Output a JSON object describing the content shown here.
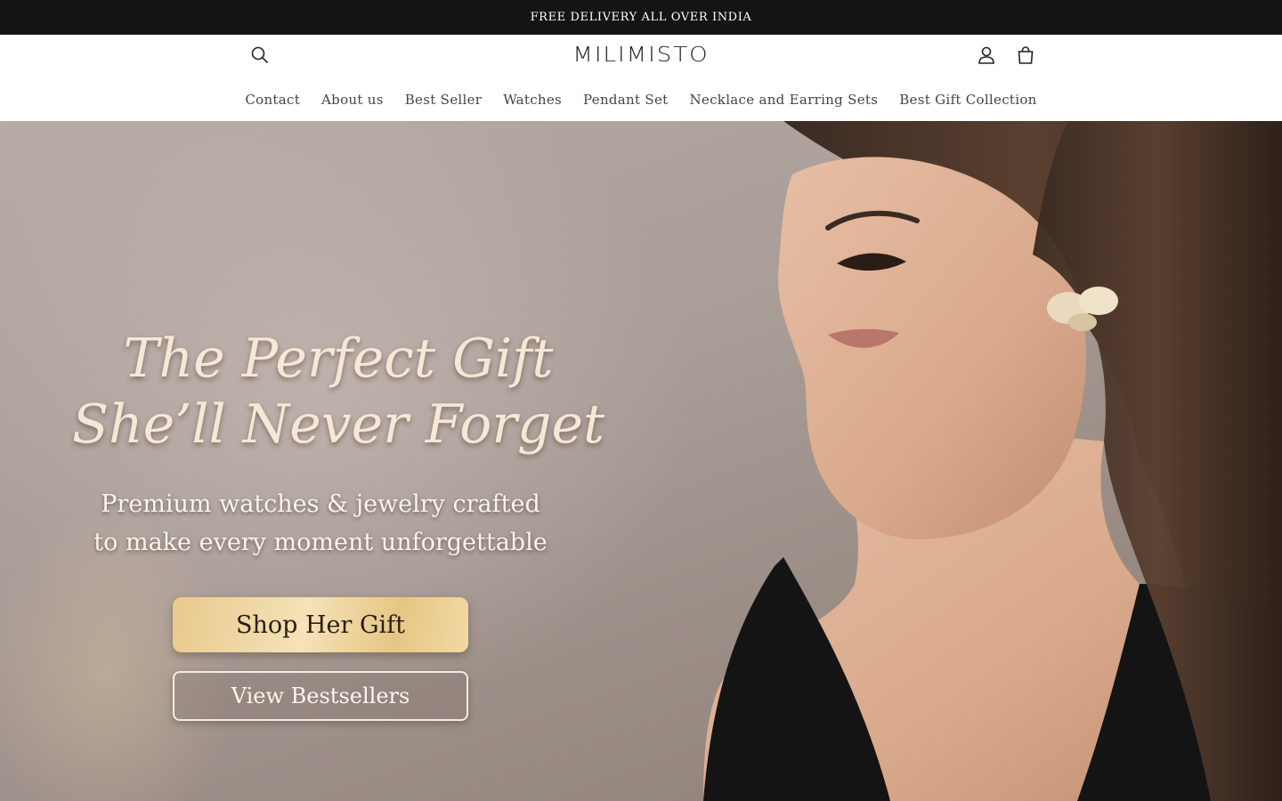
{
  "announcement": {
    "text": "FREE DELIVERY ALL OVER INDIA"
  },
  "header": {
    "logo": "MILIMISTO",
    "icons": {
      "search": "search-icon",
      "account": "account-icon",
      "cart": "cart-icon"
    }
  },
  "nav": {
    "items": [
      {
        "label": "Contact"
      },
      {
        "label": "About us"
      },
      {
        "label": "Best Seller"
      },
      {
        "label": "Watches"
      },
      {
        "label": "Pendant Set"
      },
      {
        "label": "Necklace and Earring Sets"
      },
      {
        "label": "Best Gift Collection"
      }
    ]
  },
  "hero": {
    "headline_line1": "The Perfect Gift",
    "headline_line2": "She’ll Never Forget",
    "sub_line1": "Premium watches & jewelry crafted",
    "sub_line2": "to make every moment unforgettable",
    "primary_cta": "Shop Her Gift",
    "secondary_cta": "View Bestsellers"
  },
  "colors": {
    "announcement_bg": "#141414",
    "gold_button": "#ecd29f",
    "hero_bg": "#a99d98"
  }
}
